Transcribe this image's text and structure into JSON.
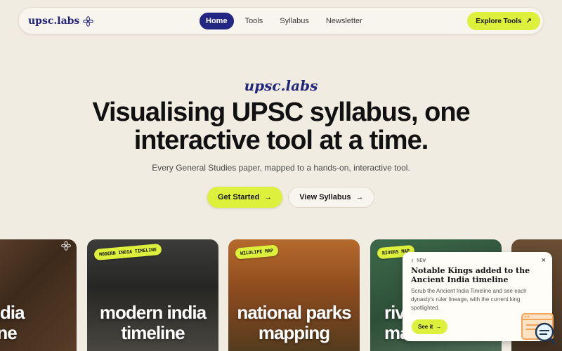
{
  "nav": {
    "logo": "upsc.labs",
    "links": [
      "Home",
      "Tools",
      "Syllabus",
      "Newsletter"
    ],
    "explore": "Explore Tools",
    "explore_icon": "arrow-up-right-icon"
  },
  "hero": {
    "brand": "upsc.labs",
    "headline_line1": "Visualising UPSC syllabus, one",
    "headline_line2": "interactive tool at a time.",
    "subtitle": "Every General Studies paper, mapped to a hands-on, interactive tool.",
    "primary_cta": "Get Started",
    "secondary_cta": "View Syllabus",
    "cta_icon": "arrow-right-icon"
  },
  "cards": [
    {
      "tag": "",
      "title_line1": "ent india",
      "title_line2": "meline"
    },
    {
      "tag": "MODERN INDIA TIMELINE",
      "title_line1": "modern india",
      "title_line2": "timeline"
    },
    {
      "tag": "WILDLIFE MAP",
      "title_line1": "national parks",
      "title_line2": "mapping"
    },
    {
      "tag": "RIVERS MAP",
      "title_line1": "riv",
      "title_line2": "ma"
    },
    {
      "tag": "",
      "title_line1": "",
      "title_line2": ""
    }
  ],
  "popup": {
    "label": "NEW",
    "title": "Notable Kings added to the Ancient India timeline",
    "body": "Scrub the Ancient India Timeline and see each dynasty's ruler lineage, with the current king spotlighted.",
    "button": "See it",
    "close": "×"
  },
  "colors": {
    "background": "#f1ece2",
    "accent": "#dcf03c",
    "brand": "#22267a"
  }
}
